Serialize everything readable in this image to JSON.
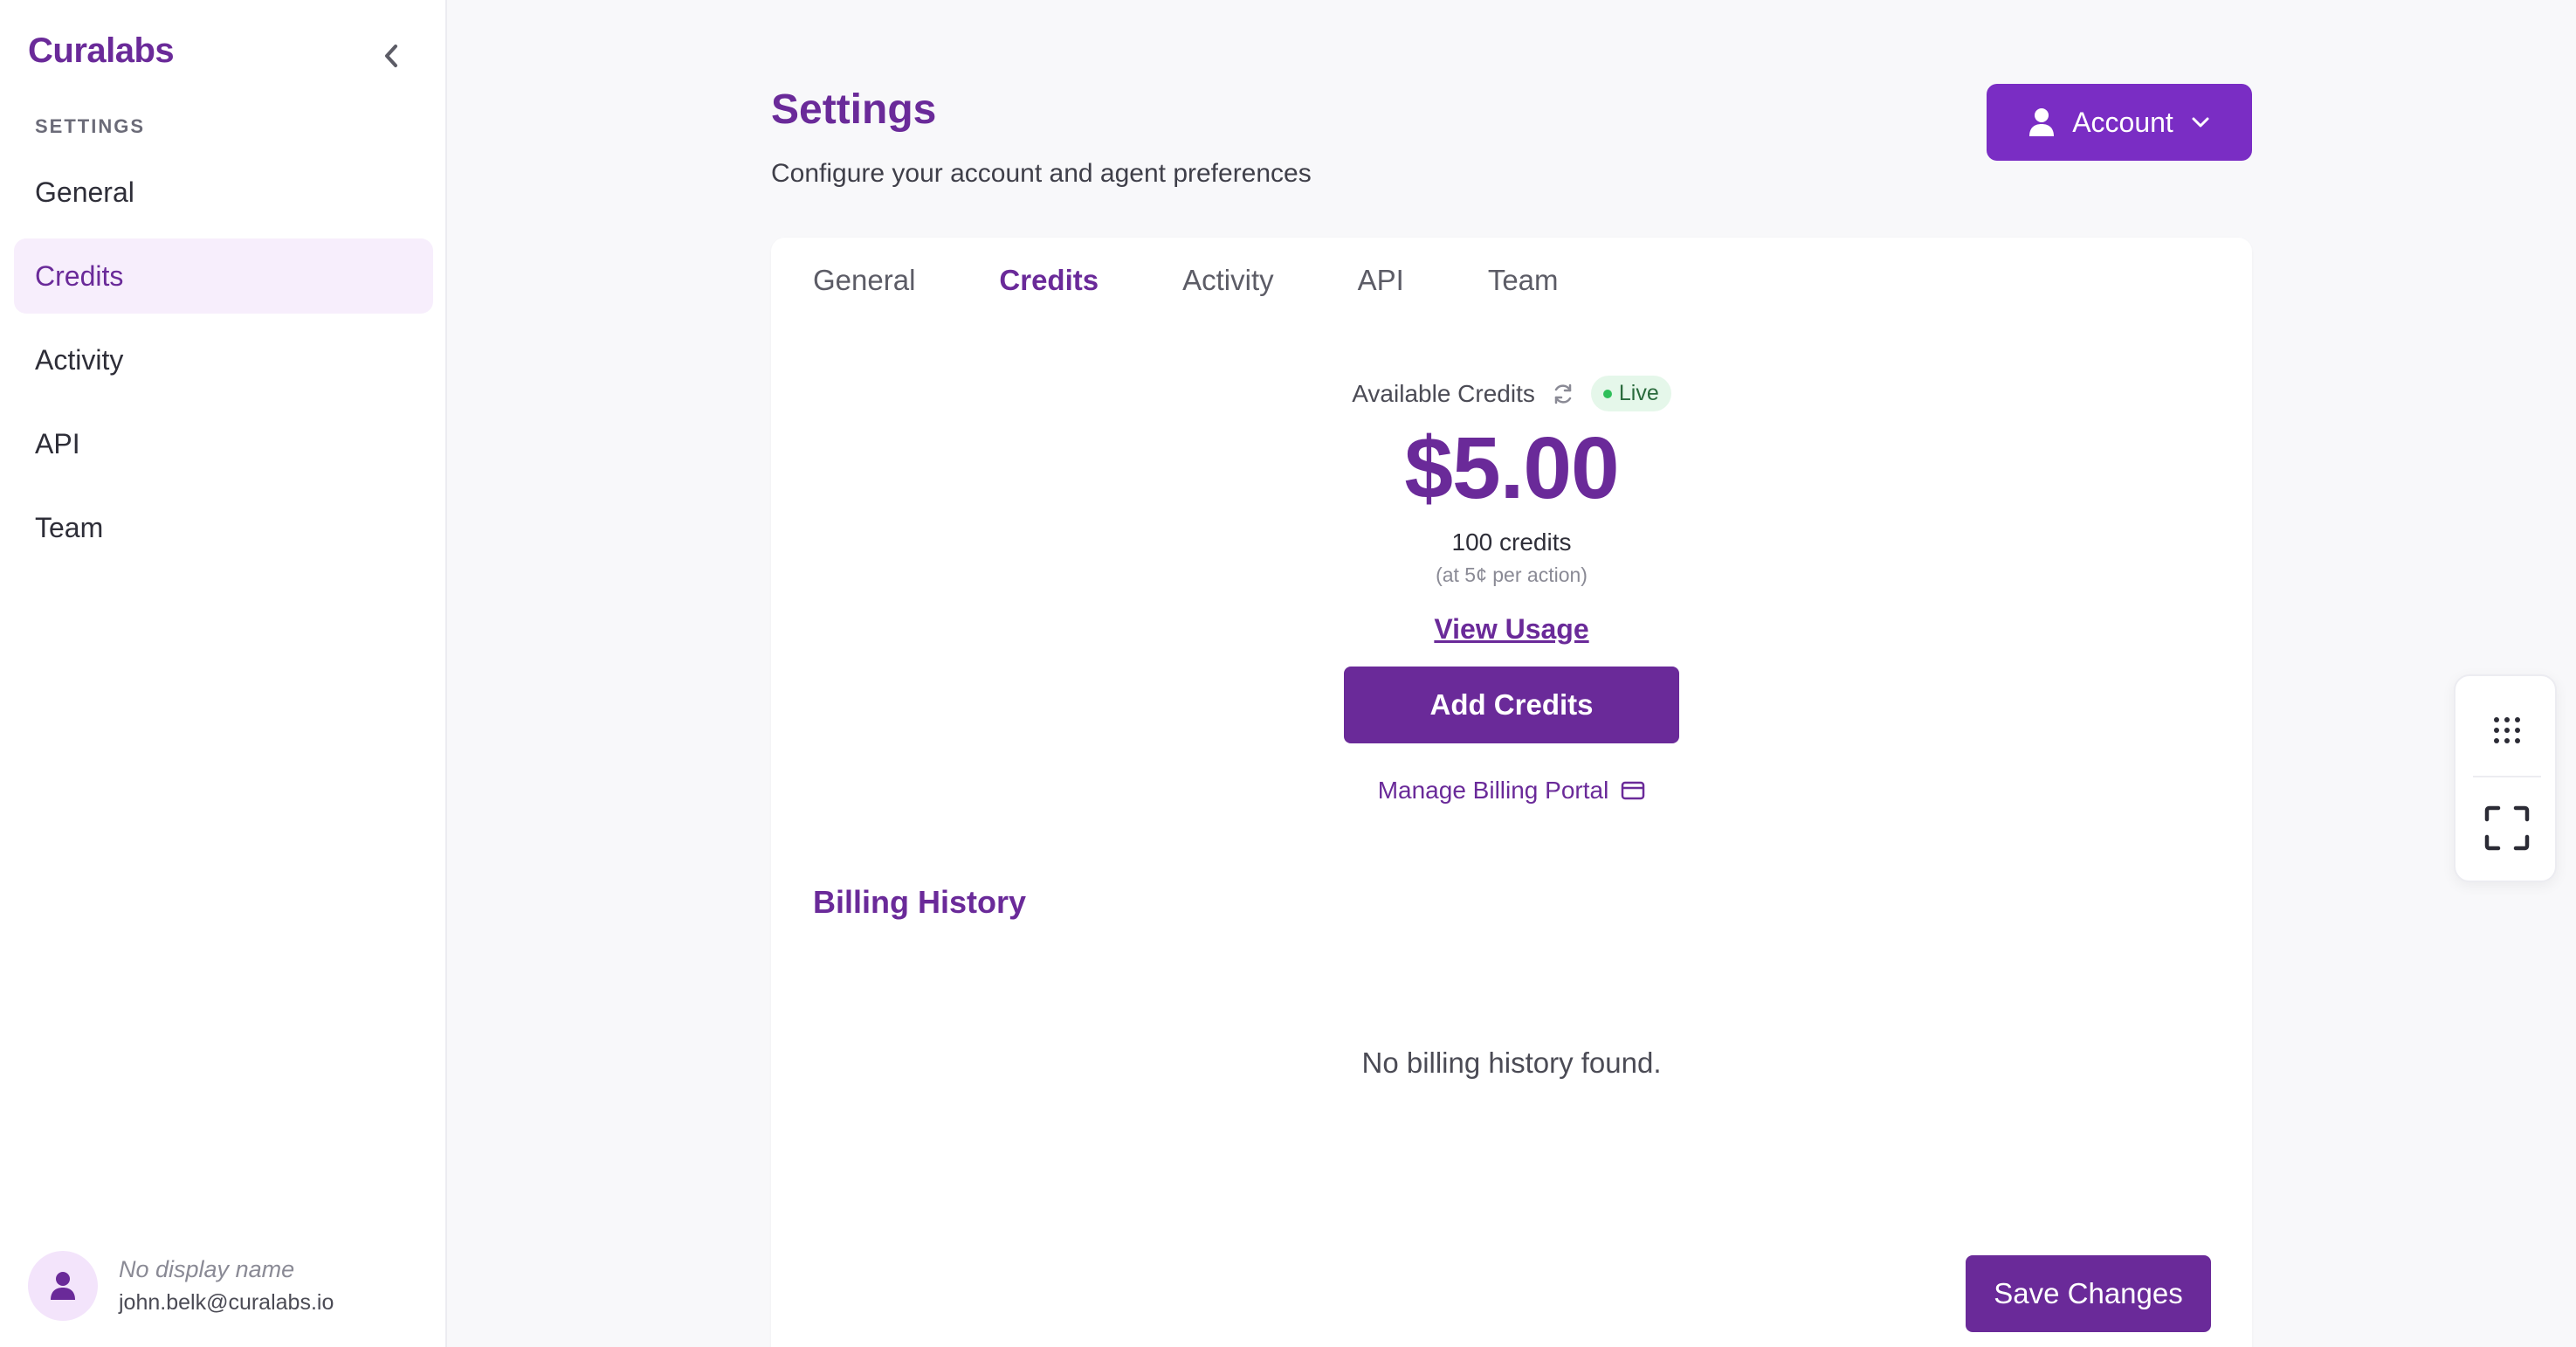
{
  "sidebar": {
    "brand": "Curalabs",
    "section_label": "SETTINGS",
    "items": [
      {
        "label": "General",
        "active": false
      },
      {
        "label": "Credits",
        "active": true
      },
      {
        "label": "Activity",
        "active": false
      },
      {
        "label": "API",
        "active": false
      },
      {
        "label": "Team",
        "active": false
      }
    ],
    "user": {
      "display_name": "No display name",
      "email": "john.belk@curalabs.io"
    }
  },
  "header": {
    "title": "Settings",
    "subtitle": "Configure your account and agent preferences",
    "account_button": "Account"
  },
  "tabs": [
    {
      "label": "General",
      "active": false
    },
    {
      "label": "Credits",
      "active": true
    },
    {
      "label": "Activity",
      "active": false
    },
    {
      "label": "API",
      "active": false
    },
    {
      "label": "Team",
      "active": false
    }
  ],
  "credits": {
    "available_label": "Available Credits",
    "live_label": "Live",
    "amount": "$5.00",
    "count": "100 credits",
    "rate_note": "(at 5¢ per action)",
    "view_usage": "View Usage",
    "add_button": "Add Credits",
    "billing_portal": "Manage Billing Portal"
  },
  "billing": {
    "title": "Billing History",
    "empty_message": "No billing history found."
  },
  "actions": {
    "save_label": "Save Changes"
  },
  "colors": {
    "brand": "#6a2a99",
    "account_button": "#7a2dc4",
    "active_nav_bg": "#f7eefc",
    "live_badge_bg": "#e5f7ea",
    "live_dot": "#2fbf5a"
  },
  "icons": {
    "collapse": "chevron-left-icon",
    "refresh": "refresh-icon",
    "account": "user-icon",
    "dropdown": "chevron-down-icon",
    "billing_portal": "credit-card-icon",
    "widget_top": "grid-dots-icon",
    "widget_bottom": "fullscreen-icon"
  }
}
